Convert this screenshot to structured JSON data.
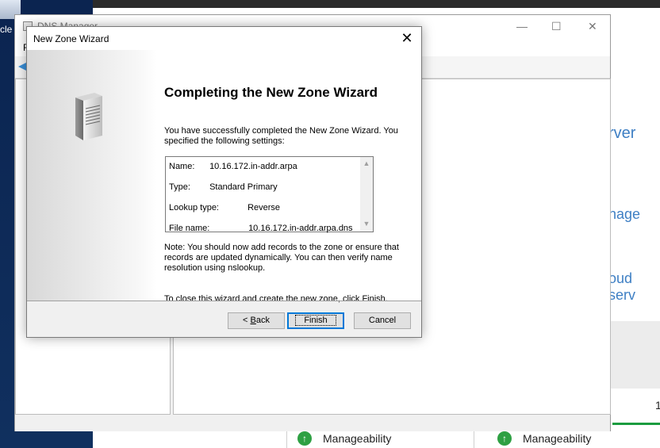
{
  "desktop": {
    "recycle_label": "cle"
  },
  "server_manager": {
    "right_texts": [
      "rver",
      "nage",
      "oud serv"
    ],
    "bottom_items": [
      "Manageability",
      "Manageability"
    ],
    "number_fragment": "1"
  },
  "dns_manager": {
    "title": "DNS Manager",
    "menu_fragment": "F"
  },
  "wizard": {
    "title": "New Zone Wizard",
    "heading": "Completing the New Zone Wizard",
    "intro": "You have successfully completed the New Zone Wizard. You specified the following settings:",
    "settings": [
      {
        "label": "Name:",
        "value": "10.16.172.in-addr.arpa"
      },
      {
        "label": "Type:",
        "value": "Standard Primary"
      },
      {
        "label": "Lookup type:",
        "value": "Reverse"
      },
      {
        "label": "File name:",
        "value": "10.16.172.in-addr.arpa.dns"
      }
    ],
    "note": "Note: You should now add records to the zone or ensure that records are updated dynamically. You can then verify name resolution using nslookup.",
    "close_text": "To close this wizard and create the new zone, click Finish.",
    "buttons": {
      "back_underline": "B",
      "back_prefix": "< ",
      "back_rest": "ack",
      "finish": "Finish",
      "cancel": "Cancel"
    }
  }
}
